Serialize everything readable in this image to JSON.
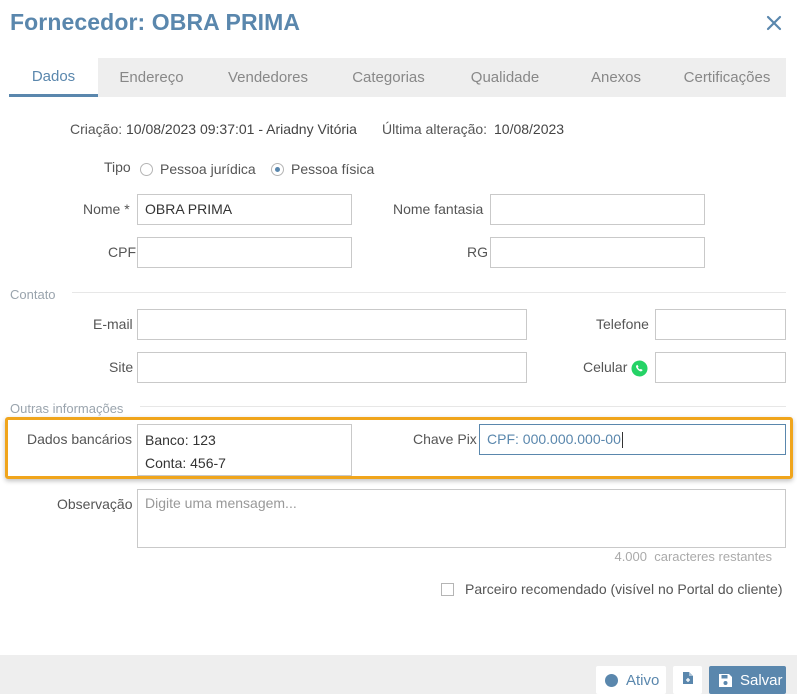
{
  "title": "Fornecedor: OBRA PRIMA",
  "tabs": [
    "Dados",
    "Endereço",
    "Vendedores",
    "Categorias",
    "Qualidade",
    "Anexos",
    "Certificações"
  ],
  "meta": {
    "creation_label": "Criação:",
    "creation_value": "10/08/2023 09:37:01 - Ariadny Vitória",
    "last_change_label": "Última alteração:",
    "last_change_value": "10/08/2023"
  },
  "tipo": {
    "label": "Tipo",
    "options": [
      "Pessoa jurídica",
      "Pessoa física"
    ],
    "selected": "Pessoa física"
  },
  "fields": {
    "nome_label": "Nome *",
    "nome_value": "OBRA PRIMA",
    "fantasia_label": "Nome fantasia",
    "fantasia_value": "",
    "cpf_label": "CPF",
    "cpf_value": "",
    "rg_label": "RG",
    "rg_value": ""
  },
  "contato": {
    "section": "Contato",
    "email_label": "E-mail",
    "telefone_label": "Telefone",
    "site_label": "Site",
    "celular_label": "Celular"
  },
  "outras": {
    "section": "Outras informações",
    "bancarios_label": "Dados bancários",
    "bancarios_lines": [
      "Banco: 123",
      "Conta: 456-7"
    ],
    "pix_label": "Chave Pix",
    "pix_value": "CPF: 000.000.000-00",
    "obs_label": "Observação",
    "obs_placeholder": "Digite uma mensagem...",
    "remaining": "4.000  caracteres restantes",
    "recommended_label": "Parceiro recomendado (visível no Portal do cliente)"
  },
  "footer": {
    "status_label": "Ativo",
    "save_label": "Salvar"
  },
  "colors": {
    "accent": "#5a87ad",
    "highlight": "#f0a51c",
    "whatsapp": "#25d366"
  }
}
